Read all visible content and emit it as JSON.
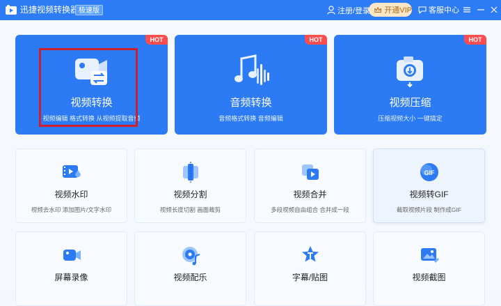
{
  "titlebar": {
    "app_title": "迅捷视频转换器",
    "edition_badge": "极速版",
    "login": "注册/登录",
    "vip": "开通VIP",
    "service": "客服中心"
  },
  "big_cards": [
    {
      "title": "视频转换",
      "sub": "视频编辑  格式转换  从视频提取音频",
      "badge": "HOT",
      "icon": "video-convert-icon"
    },
    {
      "title": "音频转换",
      "sub": "音频格式转换  音频编辑",
      "badge": "HOT",
      "icon": "audio-convert-icon"
    },
    {
      "title": "视频压缩",
      "sub": "压缩视频大小  一键搞定",
      "badge": "HOT",
      "icon": "video-compress-icon"
    }
  ],
  "small_cards": [
    {
      "title": "视频水印",
      "sub": "视频去水印  添加图片/文字水印",
      "icon": "watermark-icon"
    },
    {
      "title": "视频分割",
      "sub": "视频长度切割  画面裁剪",
      "icon": "video-split-icon"
    },
    {
      "title": "视频合并",
      "sub": "多段视频自由组合  合并成一段",
      "icon": "video-merge-icon"
    },
    {
      "title": "视频转GIF",
      "sub": "截取视频片段  制作成GIF",
      "icon": "gif-icon"
    },
    {
      "title": "屏幕录像",
      "sub": "",
      "icon": "screen-record-icon"
    },
    {
      "title": "视频配乐",
      "sub": "",
      "icon": "video-music-icon"
    },
    {
      "title": "字幕/贴图",
      "sub": "",
      "icon": "subtitle-sticker-icon"
    },
    {
      "title": "视频截图",
      "sub": "",
      "icon": "screenshot-icon"
    }
  ],
  "colors": {
    "accent": "#2d7cf6",
    "hot": "#ff4d4f",
    "selection": "#cf1f2a"
  }
}
